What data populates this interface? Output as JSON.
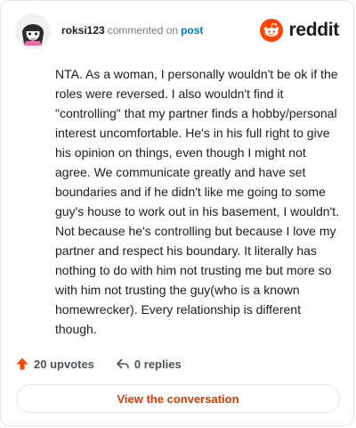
{
  "header": {
    "username": "roksi123",
    "action": "commented on",
    "post_link": "post",
    "brand": "reddit",
    "brand_color": "#ff4500"
  },
  "comment": {
    "text": "NTA. As a woman, I personally wouldn't be ok if the roles were reversed. I also wouldn't find it \"controlling\" that my partner finds a hobby/personal interest uncomfortable. He's in his full right to give his opinion on things, even though I might not agree. We communicate greatly and have set boundaries and if he didn't like me going to some guy's house to work out in his basement, I wouldn't. Not because he's controlling but because I love my partner and respect his boundary. It literally has nothing to do with him not trusting me but more so with him not trusting the guy(who is a known homewrecker). Every relationship is different though."
  },
  "stats": {
    "upvotes": "20 upvotes",
    "replies": "0 replies",
    "upvote_icon": "arrow-up-icon",
    "reply_icon": "reply-arrow-icon"
  },
  "cta": {
    "label": "View the conversation",
    "color": "#d93a00"
  }
}
